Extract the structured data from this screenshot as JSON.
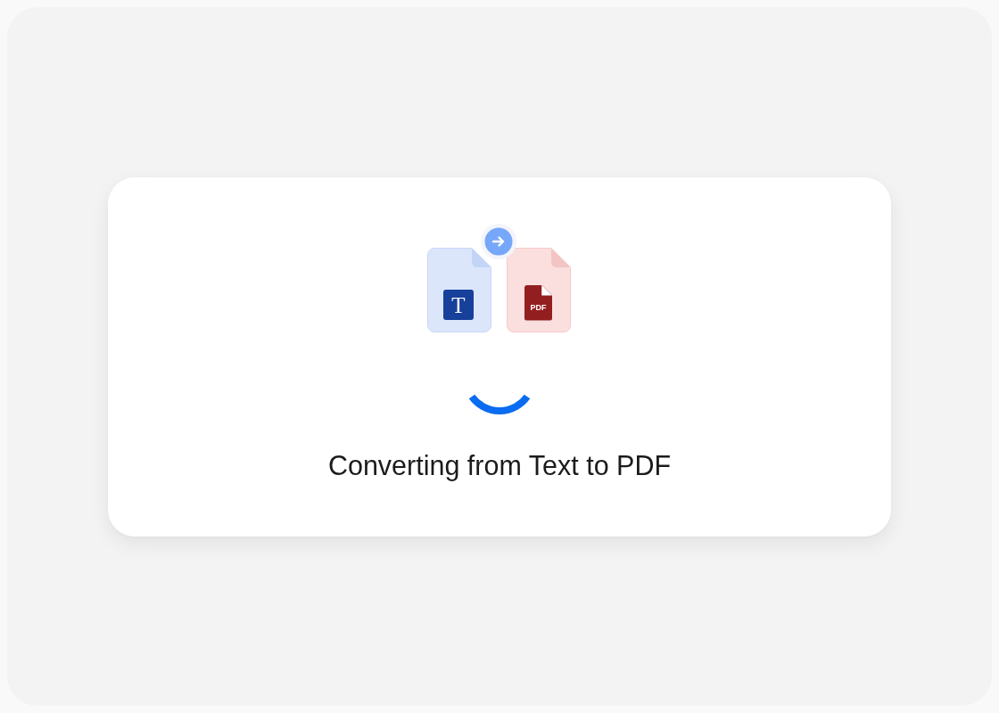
{
  "conversion": {
    "files": [
      {
        "kind": "text",
        "label": "T"
      },
      {
        "kind": "pdf",
        "label": "PDF"
      }
    ],
    "status": "Converting from Text to PDF"
  }
}
